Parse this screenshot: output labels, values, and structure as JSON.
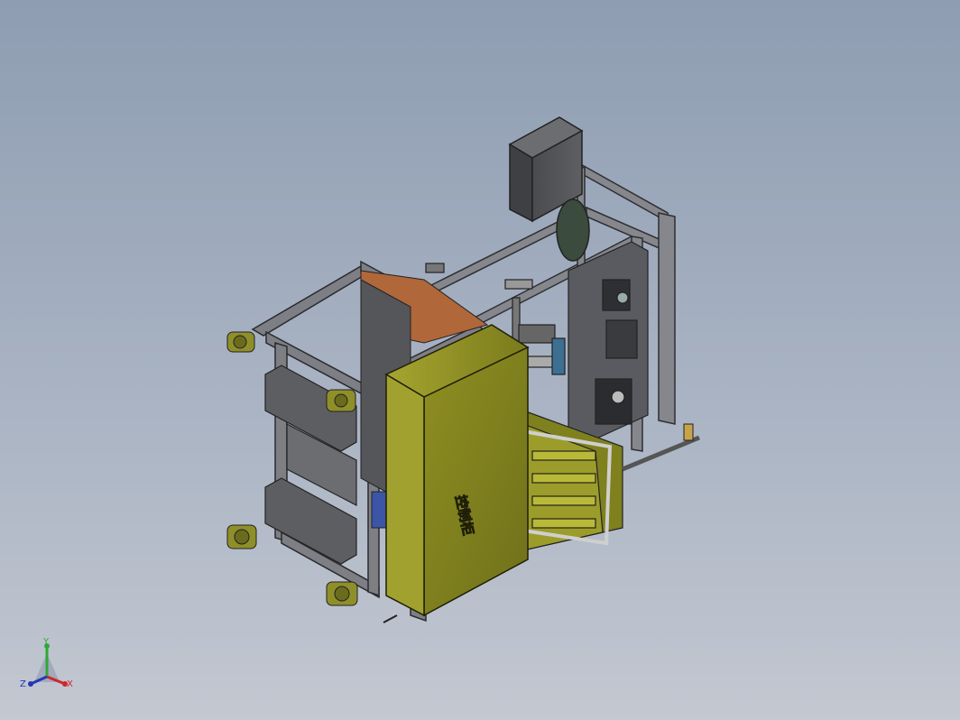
{
  "viewport": {
    "background_top": "#8e9db2",
    "background_bottom": "#c3c8d1"
  },
  "model": {
    "frame_color": "#7d7f84",
    "frame_dark": "#54565a",
    "cabinet_color": "#8a8a1f",
    "cabinet_label": "控制柜",
    "caster_color": "#8f8f2a"
  },
  "triad": {
    "x_label": "X",
    "y_label": "Y",
    "z_label": "Z",
    "x_color": "#d0262b",
    "y_color": "#2fa836",
    "z_color": "#2436b8"
  }
}
